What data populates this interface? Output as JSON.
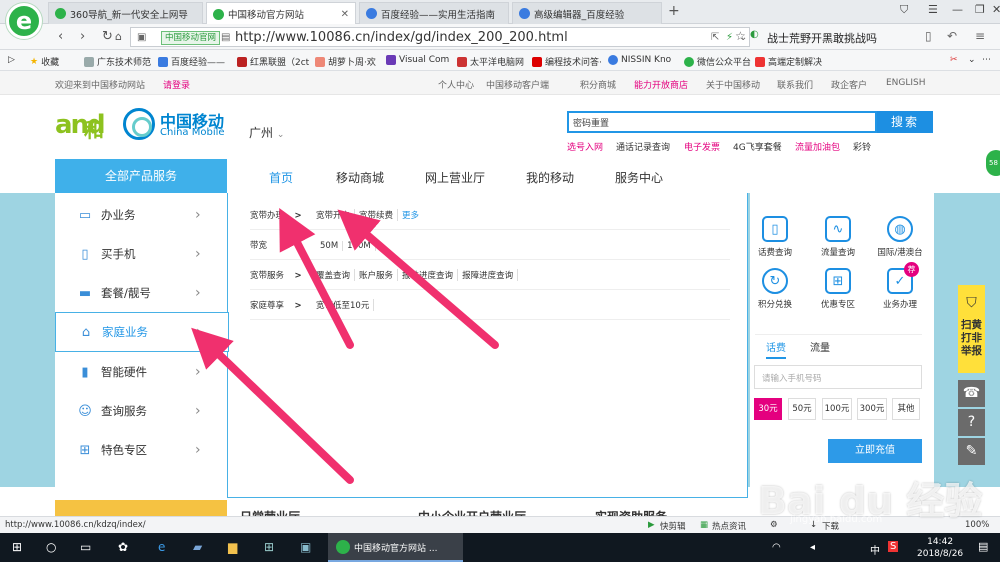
{
  "browser": {
    "tabs": [
      {
        "title": "360导航_新一代安全上网导",
        "color": "#2db24a"
      },
      {
        "title": "中国移动官方网站",
        "color": "#2db24a"
      },
      {
        "title": "百度经验——实用生活指南",
        "color": "#3a7be0"
      },
      {
        "title": "高级编辑器_百度经验",
        "color": "#3a7be0"
      }
    ],
    "site_badge": "中国移动官网",
    "url": "http://www.10086.cn/index/gd/index_200_200.html",
    "search_text": "战士荒野开黑敢挑战吗",
    "bookmarks": [
      "收藏",
      "广东技术师范",
      "百度经验——",
      "红黑联盟（2ct",
      "胡萝卜周·欢",
      "Visual Com",
      "太平洋电脑网",
      "编程技术问答·",
      "NISSIN Kno",
      "微信公众平台",
      "高端定制解决"
    ]
  },
  "site_top": {
    "welcome": "欢迎来到中国移动网站",
    "login": "请登录",
    "links": [
      "个人中心",
      "中国移动客户端",
      "积分商城",
      "能力开放商店",
      "关于中国移动",
      "联系我们",
      "政企客户",
      "ENGLISH"
    ]
  },
  "header": {
    "logo_and": "and",
    "logo_he": "和",
    "cm_cn": "中国移动",
    "cm_en": "China Mobile",
    "city": "广州",
    "search_value": "密码重置",
    "search_button": "搜索",
    "hot_keywords": [
      {
        "text": "选号入网",
        "color": "#e4007f"
      },
      {
        "text": "通话记录查询",
        "color": "#333333"
      },
      {
        "text": "电子发票",
        "color": "#e4007f"
      },
      {
        "text": "4G飞享套餐",
        "color": "#333333"
      },
      {
        "text": "流量加油包",
        "color": "#e4007f"
      },
      {
        "text": "彩铃",
        "color": "#333333"
      }
    ]
  },
  "nav": {
    "all_products": "全部产品服务",
    "items": [
      "首页",
      "移动商城",
      "网上营业厅",
      "我的移动",
      "服务中心"
    ]
  },
  "sidebar": {
    "items": [
      "办业务",
      "买手机",
      "套餐/靓号",
      "家庭业务",
      "智能硬件",
      "查询服务",
      "特色专区"
    ]
  },
  "panel": {
    "rows": [
      {
        "label": "宽带办理",
        "links": [
          "宽带开户",
          "宽带续费",
          "更多"
        ]
      },
      {
        "label": "带宽",
        "links": [
          "50M",
          "100M"
        ]
      },
      {
        "label": "宽带服务",
        "links": [
          "覆盖查询",
          "账户服务",
          "报装进度查询",
          "报障进度查询"
        ]
      },
      {
        "label": "家庭尊享",
        "links": [
          "宽带低至10元"
        ]
      }
    ]
  },
  "quick": {
    "items": [
      "话费查询",
      "流量查询",
      "国际/港澳台",
      "积分兑换",
      "优惠专区",
      "业务办理"
    ],
    "hot_badge": "荐"
  },
  "recharge": {
    "tabs": [
      "话费",
      "流量"
    ],
    "phone_placeholder": "请输入手机号码",
    "amounts": [
      "30元",
      "50元",
      "100元",
      "300元",
      "其他"
    ],
    "button": "立即充值"
  },
  "float": {
    "report": "扫黄打非举报",
    "badge": "58"
  },
  "bottom": {
    "titles": [
      "日常营业厅",
      "中小企业开户营业厅",
      "实现资助服务"
    ]
  },
  "statusbar": {
    "link": "http://www.10086.cn/kdzq/index/",
    "items": [
      "快剪辑",
      "热点资讯",
      "下载",
      "100%"
    ]
  },
  "taskbar": {
    "app_title": "中国移动官方网站 ...",
    "time": "14:42",
    "date": "2018/8/26",
    "ime": "中"
  },
  "watermark": {
    "main": "Bai du 经验",
    "sub": "jingyan.baidu.com"
  }
}
